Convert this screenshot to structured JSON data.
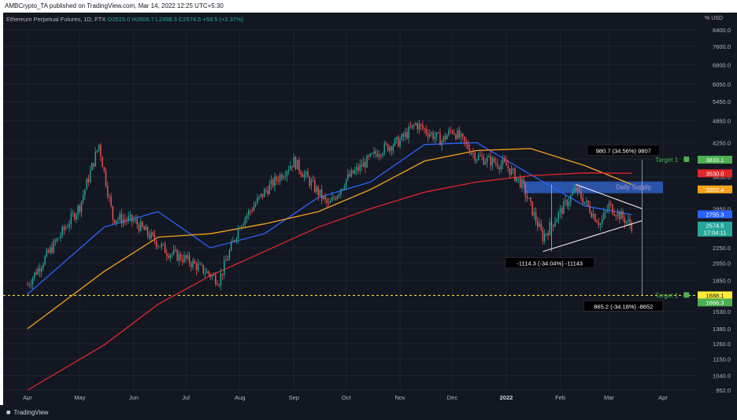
{
  "header": {
    "publisher_text": "AMBCrypto_TA published on TradingView.com, Mar 14, 2022 12:25 UTC+5:30"
  },
  "legend": {
    "symbol": "Ethereum Perpetual Futures, 1D, FTX",
    "open": "O2515.0",
    "high": "H2606.7",
    "low": "L2498.3",
    "close": "C2574.5",
    "change": "+59.5 (+2.37%)"
  },
  "currency_label": "% USD",
  "footer": {
    "brand": "TradingView"
  },
  "colors": {
    "background": "#131722",
    "up_candle": "#26a69a",
    "down_candle": "#ef5350",
    "ma_blue": "#2962ff",
    "ma_orange": "#f7a21b",
    "ma_red": "#e0262b",
    "supply_zone": "#2f5fbf",
    "target_green": "#4caf50"
  },
  "chart_data": {
    "type": "line",
    "scale": "log",
    "ylim": [
      952,
      8400
    ],
    "yticks": [
      "8400.0",
      "7600.0",
      "6800.0",
      "6050.0",
      "5450.0",
      "4850.0",
      "4250.0",
      "3850.0",
      "3450.0",
      "2850.0",
      "2450.0",
      "2250.0",
      "2050.0",
      "1850.0",
      "1530.0",
      "1380.0",
      "1260.0",
      "1150.0",
      "1040.0",
      "952.0"
    ],
    "xticks": [
      "Apr",
      "May",
      "Jun",
      "Jul",
      "Aug",
      "Sep",
      "Oct",
      "Nov",
      "Dec",
      "2022",
      "Feb",
      "Mar",
      "Apr"
    ],
    "series": [
      {
        "kind": "candlestick_close_approx",
        "x": [
          "2021-04-01",
          "2021-04-15",
          "2021-05-01",
          "2021-05-12",
          "2021-05-20",
          "2021-06-01",
          "2021-06-20",
          "2021-07-01",
          "2021-07-20",
          "2021-08-01",
          "2021-08-15",
          "2021-09-01",
          "2021-09-07",
          "2021-09-21",
          "2021-10-01",
          "2021-10-20",
          "2021-11-01",
          "2021-11-10",
          "2021-11-25",
          "2021-12-01",
          "2021-12-15",
          "2022-01-01",
          "2022-01-10",
          "2022-01-22",
          "2022-02-01",
          "2022-02-10",
          "2022-02-24",
          "2022-03-01",
          "2022-03-14"
        ],
        "values": [
          1800,
          2250,
          2900,
          4200,
          2700,
          2650,
          2200,
          2100,
          1850,
          2600,
          3150,
          3800,
          3500,
          2900,
          3400,
          4050,
          4300,
          4750,
          4300,
          4600,
          3900,
          3700,
          3300,
          2400,
          2800,
          3200,
          2600,
          2900,
          2574.5
        ]
      },
      {
        "name": "",
        "kind": "ma_blue",
        "x": [
          "2021-04-01",
          "2021-05-15",
          "2021-06-15",
          "2021-07-15",
          "2021-08-15",
          "2021-09-15",
          "2021-10-15",
          "2021-11-15",
          "2021-12-15",
          "2022-01-15",
          "2022-02-15",
          "2022-03-14"
        ],
        "values": [
          1700,
          2550,
          2800,
          2250,
          2450,
          3050,
          3350,
          4200,
          4250,
          3500,
          2900,
          2750
        ]
      },
      {
        "name": "",
        "kind": "ma_orange",
        "x": [
          "2021-04-01",
          "2021-05-15",
          "2021-06-15",
          "2021-07-15",
          "2021-08-15",
          "2021-09-15",
          "2021-10-15",
          "2021-11-15",
          "2021-12-15",
          "2022-01-15",
          "2022-02-15",
          "2022-03-14"
        ],
        "values": [
          1380,
          1950,
          2400,
          2450,
          2600,
          2800,
          3200,
          3800,
          4050,
          4100,
          3700,
          3300
        ]
      },
      {
        "name": "",
        "kind": "ma_red",
        "x": [
          "2021-04-01",
          "2021-05-15",
          "2021-06-15",
          "2021-07-15",
          "2021-08-15",
          "2021-09-15",
          "2021-10-15",
          "2021-11-15",
          "2021-12-15",
          "2022-01-15",
          "2022-02-15",
          "2022-03-14"
        ],
        "values": [
          952,
          1250,
          1600,
          1900,
          2200,
          2550,
          2850,
          3150,
          3350,
          3480,
          3540,
          3530
        ]
      }
    ],
    "price_labels": [
      {
        "text": "3833.1",
        "value": 3833.1,
        "color": "#4caf50"
      },
      {
        "text": "3530.0",
        "value": 3530.0,
        "color": "#e0262b"
      },
      {
        "text": "3202.4",
        "value": 3202.4,
        "color": "#f7a21b"
      },
      {
        "text": "2755.3",
        "value": 2755.3,
        "color": "#2962ff"
      },
      {
        "text": "2574.5",
        "value": 2574.5,
        "color": "#26a69a"
      },
      {
        "text": "17:04:11",
        "value": 2574.5,
        "color": "#26a69a"
      },
      {
        "text": "1688.1",
        "value": 1688.1,
        "color": "#ffeb3b"
      },
      {
        "text": "1666.3",
        "value": 1666.3,
        "color": "#4caf50"
      }
    ],
    "annotations": [
      {
        "name": "target-top",
        "text": "Target 1",
        "value": 3833.1,
        "date": "2022-03-24"
      },
      {
        "name": "target-bottom",
        "text": "Target 1",
        "value": 1688.1,
        "date": "2022-03-24"
      },
      {
        "name": "measure-up",
        "text": "980.7 (34.56%) 9807",
        "value": 4050,
        "date": "2022-03-12"
      },
      {
        "name": "measure-down",
        "text": "865.2 (-34.18%) -8652",
        "value": 1580,
        "date": "2022-03-12"
      },
      {
        "name": "measure-triangle",
        "text": "-1114.3 (-34.04%) -11143",
        "value": 2050,
        "date": "2022-01-26"
      },
      {
        "name": "supply-zone-label",
        "text": "Daily Supply",
        "value": 3250,
        "date": "2022-03-05"
      }
    ],
    "supply_zone": {
      "from_date": "2022-01-11",
      "to_date": "2022-04-01",
      "high": 3360,
      "low": 3130
    },
    "triangle_upper": {
      "x": [
        "2022-02-10",
        "2022-03-20"
      ],
      "values": [
        3300,
        2850
      ]
    },
    "triangle_lower": {
      "x": [
        "2022-01-22",
        "2022-03-20"
      ],
      "values": [
        2200,
        2650
      ]
    },
    "horizontal_support": {
      "value": 1688.1
    },
    "grid": true
  }
}
